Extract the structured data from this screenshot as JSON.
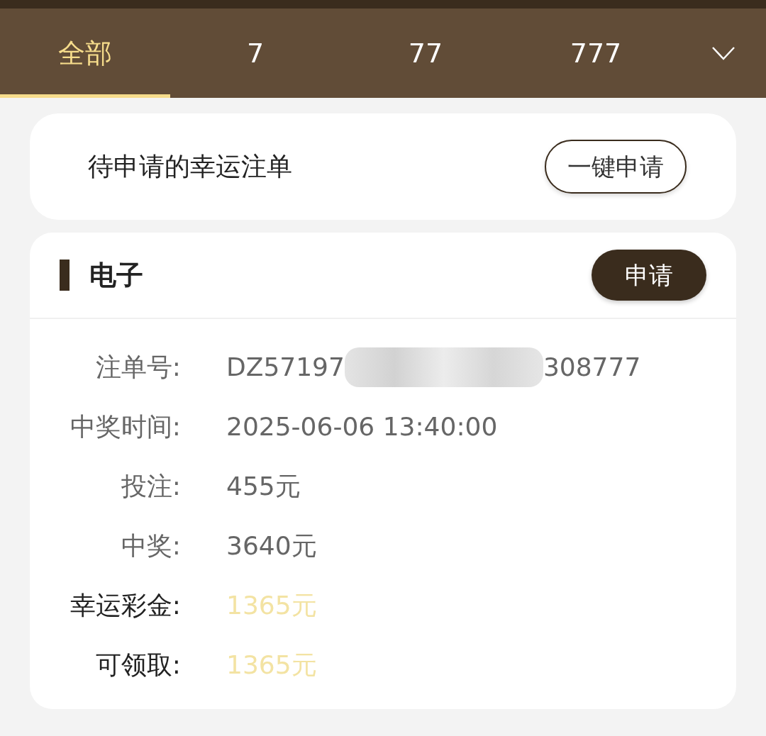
{
  "tabs": [
    {
      "label": "全部",
      "selected": true
    },
    {
      "label": "7",
      "selected": false
    },
    {
      "label": "77",
      "selected": false
    },
    {
      "label": "777",
      "selected": false
    }
  ],
  "pending": {
    "title": "待申请的幸运注单",
    "button": "一键申请"
  },
  "card": {
    "title": "电子",
    "button": "申请",
    "rows": [
      {
        "label": "注单号:",
        "kind": "redacted",
        "value_start": "DZ57197",
        "value_end": "308777"
      },
      {
        "label": "中奖时间:",
        "kind": "plain",
        "value": "2025-06-06 13:40:00"
      },
      {
        "label": "投注:",
        "kind": "plain",
        "value": "455元"
      },
      {
        "label": "中奖:",
        "kind": "plain",
        "value": "3640元"
      },
      {
        "label": "幸运彩金:",
        "kind": "highlight",
        "value": "1365元"
      },
      {
        "label": "可领取:",
        "kind": "highlight",
        "value": "1365元"
      }
    ]
  }
}
